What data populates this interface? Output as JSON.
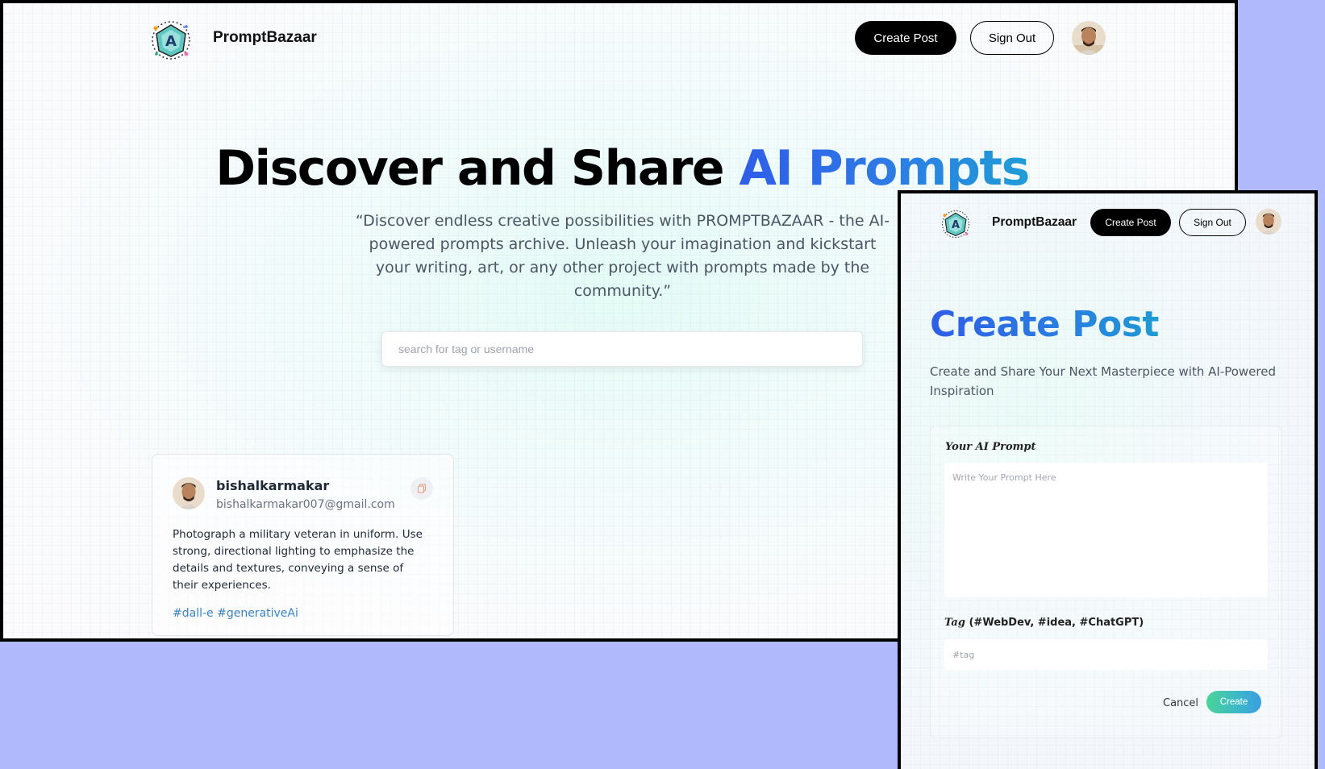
{
  "home": {
    "nav": {
      "brand": "PromptBazaar",
      "create_post_label": "Create Post",
      "sign_out_label": "Sign Out"
    },
    "hero": {
      "title_part1": "Discover and Share ",
      "title_part2": "AI Prompts",
      "description": "“Discover endless creative possibilities with PROMPTBAZAAR - the AI-powered prompts archive. Unleash your imagination and kickstart your writing, art, or any other project with prompts made by the community.”"
    },
    "search": {
      "placeholder": "search for tag or username",
      "value": ""
    },
    "prompt_card": {
      "username": "bishalkarmakar",
      "email": "bishalkarmakar007@gmail.com",
      "prompt": "Photograph a military veteran in uniform. Use strong, directional lighting to emphasize the details and textures, conveying a sense of their experiences.",
      "tags": "#dall-e #generativeAi",
      "copy_icon": "copy-icon"
    }
  },
  "create_page": {
    "nav": {
      "brand": "PromptBazaar",
      "create_post_label": "Create Post",
      "sign_out_label": "Sign Out"
    },
    "title": "Create Post",
    "description": "Create and Share Your Next Masterpiece with AI-Powered Inspiration",
    "form": {
      "prompt_label": "Your AI Prompt",
      "prompt_placeholder": "Write Your Prompt Here",
      "tag_label_script": "Tag",
      "tag_label_rest": " (#WebDev, #idea, #ChatGPT)",
      "tag_placeholder": "#tag",
      "cancel_label": "Cancel",
      "create_label": "Create"
    }
  },
  "colors": {
    "background": "#b0b9fc",
    "accent_blue": "#2f5de8",
    "tag_blue": "#3b82c4",
    "create_gradient_start": "#4ad49a",
    "create_gradient_end": "#3a9ee3"
  }
}
